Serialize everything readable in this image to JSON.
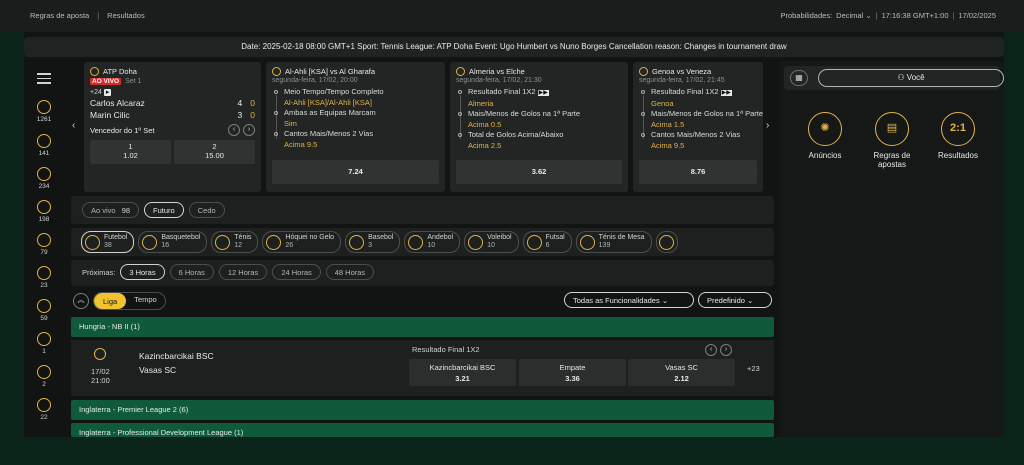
{
  "topbar": {
    "rules": "Regras de aposta",
    "results": "Resultados",
    "odds_label": "Probabilidades:",
    "odds_value": "Decimal",
    "time": "17:16:38 GMT+1:00",
    "date": "17/02/2025"
  },
  "notice": "Date: 2025-02-18 08:00 GMT+1 Sport: Tennis League: ATP Doha Event: Ugo Humbert vs Nuno Borges Cancellation reason: Changes in tournament draw",
  "sidebar": {
    "counts": [
      "1261",
      "141",
      "234",
      "198",
      "79",
      "23",
      "59",
      "1",
      "2",
      "22"
    ]
  },
  "cards": [
    {
      "title": "ATP Doha",
      "live": "AO VIVO",
      "set": "Set 1",
      "plus": "+24",
      "p1": "Carlos Alcaraz",
      "p1_score_a": "4",
      "p1_score_b": "0",
      "p2": "Marin Cilic",
      "p2_score_a": "3",
      "p2_score_b": "0",
      "market": "Vencedor do 1º Set",
      "o1_label": "1",
      "o1_value": "1.02",
      "o2_label": "2",
      "o2_value": "15.00"
    },
    {
      "title": "Al-Ahli [KSA] vs Al Gharafa",
      "sub": "segunda-feira, 17/02, 20:00",
      "lines": [
        {
          "t": "Meio Tempo/Tempo Completo",
          "s": "Al-Ahli [KSA]/Al-Ahli [KSA]"
        },
        {
          "t": "Ambas as Equipas Marcam",
          "s": "Sim"
        },
        {
          "t": "Cantos Mais/Menos 2 Vias",
          "s": "Acima 9.5"
        }
      ],
      "odd": "7.24"
    },
    {
      "title": "Almeria vs Elche",
      "sub": "segunda-feira, 17/02, 21:30",
      "lines": [
        {
          "t": "Resultado Final 1X2",
          "s": "Almeria"
        },
        {
          "t": "Mais/Menos de Golos na 1ª Parte",
          "s": "Acima 0.5"
        },
        {
          "t": "Total de Golos Acima/Abaixo",
          "s": "Acima 2.5"
        }
      ],
      "odd": "3.62"
    },
    {
      "title": "Genoa vs Veneza",
      "sub": "segunda-feira, 17/02, 21:45",
      "lines": [
        {
          "t": "Resultado Final 1X2",
          "s": "Genoa"
        },
        {
          "t": "Mais/Menos de Golos na 1ª Parte",
          "s": "Acima 1.5"
        },
        {
          "t": "Cantos Mais/Menos 2 Vias",
          "s": "Acima 9.5"
        }
      ],
      "odd": "8.76"
    }
  ],
  "time_filters": [
    {
      "label": "Ao vivo",
      "count": "98"
    },
    {
      "label": "Futuro"
    },
    {
      "label": "Cedo"
    }
  ],
  "sports": [
    {
      "name": "Futebol",
      "count": "38"
    },
    {
      "name": "Basquetebol",
      "count": "16"
    },
    {
      "name": "Ténis",
      "count": "12"
    },
    {
      "name": "Hóquei no Gelo",
      "count": "26"
    },
    {
      "name": "Basebol",
      "count": "3"
    },
    {
      "name": "Andebol",
      "count": "10"
    },
    {
      "name": "Voleibol",
      "count": "10"
    },
    {
      "name": "Futsal",
      "count": "6"
    },
    {
      "name": "Ténis de Mesa",
      "count": "139"
    }
  ],
  "next": {
    "label": "Próximas:",
    "options": [
      "3 Horas",
      "6 Horas",
      "12 Horas",
      "24 Horas",
      "48 Horas"
    ]
  },
  "view": {
    "liga": "Liga",
    "tempo": "Tempo",
    "funcs": "Todas as Funcionalidades",
    "preset": "Predefinido"
  },
  "leagues": [
    "Hungria - NB II (1)",
    "Inglaterra - Premier League 2 (6)",
    "Inglaterra - Professional Development League (1)"
  ],
  "event": {
    "date": "17/02",
    "time": "21:00",
    "home": "Kazincbarcikai BSC",
    "away": "Vasas SC",
    "market": "Resultado Final 1X2",
    "outcomes": [
      {
        "label": "Kazincbarcikai BSC",
        "odd": "3.21"
      },
      {
        "label": "Empate",
        "odd": "3.36"
      },
      {
        "label": "Vasas SC",
        "odd": "2.12"
      }
    ],
    "more": "+23"
  },
  "right": {
    "you": "Você",
    "quick": [
      {
        "label": "Anúncios",
        "icon": "megaphone-icon"
      },
      {
        "label": "Regras de apostas",
        "icon": "rules-icon"
      },
      {
        "label": "Resultados",
        "icon": "2:1"
      }
    ]
  }
}
